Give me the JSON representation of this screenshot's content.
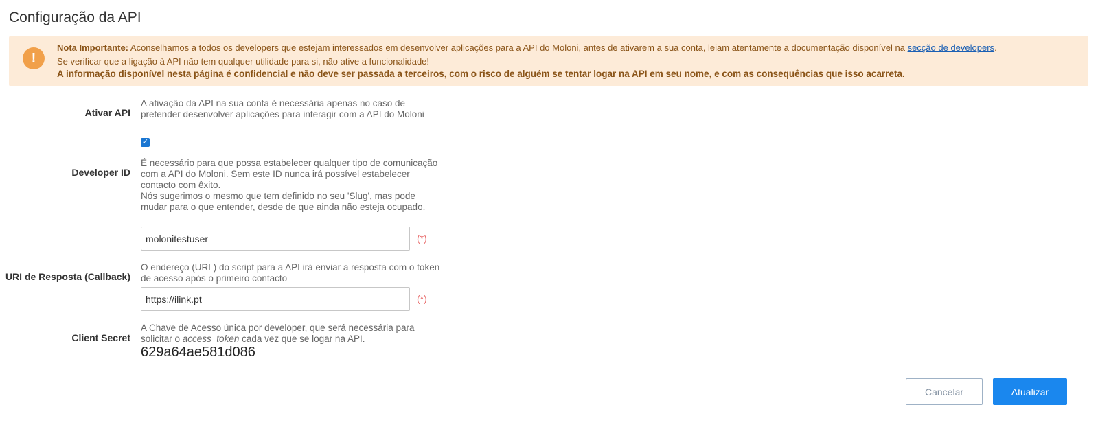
{
  "page": {
    "title": "Configuração da API"
  },
  "alert": {
    "icon": "exclamation-icon",
    "icon_glyph": "!",
    "bold_label": "Nota Importante:",
    "line1_text": " Aconselhamos a todos os developers que estejam interessados em desenvolver aplicações para a API do Moloni, antes de ativarem a sua conta, leiam atentamente a documentação disponível na ",
    "link_text": "secção de developers",
    "line1_end": ".",
    "line2_text": "Se verificar que a ligação à API não tem qualquer utilidade para si, não ative a funcionalidade!",
    "line3_text": "A informação disponível nesta página é confidencial e não deve ser passada a terceiros, com o risco de alguém se tentar logar na API em seu nome, e com as consequências que isso acarreta.",
    "bg_color": "#fdebd8",
    "icon_color": "#f1a04a"
  },
  "ativar_api": {
    "label": "Ativar API",
    "description": "A ativação da API na sua conta é necessária apenas no caso de pretender desenvolver aplicações para interagir com a API do Moloni",
    "checked": true,
    "check_glyph": "✓"
  },
  "developer_id": {
    "label": "Developer ID",
    "description1": "É necessário para que possa estabelecer qualquer tipo de comunicação com a API do Moloni. Sem este ID nunca irá possível estabelecer contacto com êxito.",
    "description2": "Nós sugerimos o mesmo que tem definido no seu 'Slug', mas pode mudar para o que entender, desde de que ainda não esteja ocupado.",
    "value": "molonitestuser",
    "required_marker": "(*)"
  },
  "callback_uri": {
    "label": "URI de Resposta (Callback)",
    "description": "O endereço (URL) do script para a API irá enviar a resposta com o token de acesso após o primeiro contacto",
    "value": "https://ilink.pt",
    "required_marker": "(*)"
  },
  "client_secret": {
    "label": "Client Secret",
    "description_before": "A Chave de Acesso única por developer, que será necessária para solicitar o ",
    "description_em": "access_token",
    "description_after": " cada vez que se logar na API.",
    "value": "629a64ae581d086"
  },
  "buttons": {
    "cancel_label": "Cancelar",
    "update_label": "Atualizar",
    "primary_color": "#1a87ee"
  }
}
